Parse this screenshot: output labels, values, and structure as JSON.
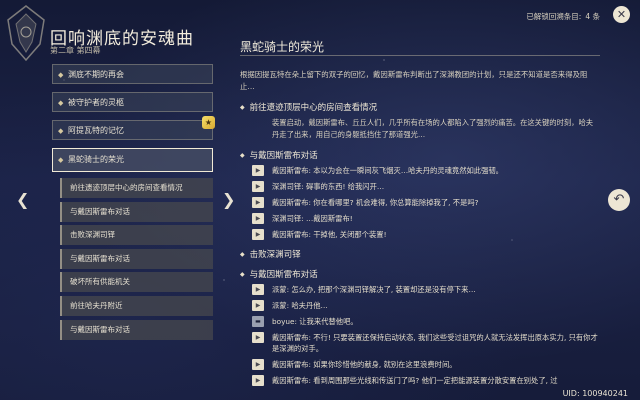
{
  "header": {
    "title": "回响渊底的安魂曲",
    "subtitle": "第二章 第四幕",
    "unlocked_label": "已解锁回溯条目:",
    "unlocked_count": "4 条"
  },
  "chapters": [
    {
      "label": "渊底不期的再会"
    },
    {
      "label": "被守护者的灵柩"
    },
    {
      "label": "阿提瓦特的记忆",
      "badge": "★"
    },
    {
      "label": "黑蛇骑士的荣光",
      "active": true
    }
  ],
  "steps": [
    "前往遗迹顶层中心的房间查看情况",
    "与戴因斯雷布对话",
    "击败深渊司铎",
    "与戴因斯雷布对话",
    "破坏所有供能机关",
    "前往哈夫丹附近",
    "与戴因斯雷布对话"
  ],
  "panel": {
    "title": "黑蛇骑士的荣光",
    "desc": "根据因提瓦特在朵上留下的双子的回忆，戴因斯雷布判断出了深渊教团的计划，只是还不知道是否来得及阻止…",
    "sections": [
      {
        "title": "前往遗迹顶层中心的房间查看情况",
        "para": "装置启动，戴因斯雷布、丘丘人们，几乎所有在场的人都陷入了强烈的痛苦。在这关键的时刻，哈夫丹走了出来，用自己的身躯抵挡住了那道强光…"
      },
      {
        "title": "与戴因斯雷布对话",
        "lines": [
          "戴因斯雷布: 本以为会在一瞬间灰飞烟灭…哈夫丹的灵魂竟然如此强韧。",
          "深渊司铎: 碍事的东西! 给我闪开…",
          "戴因斯雷布: 你在看哪里? 机会难得, 你总算能除掉我了, 不是吗?",
          "深渊司铎: …戴因斯雷布!",
          "戴因斯雷布: 干掉他, 关闭那个装置!"
        ]
      },
      {
        "title": "击败深渊司铎"
      },
      {
        "title": "与戴因斯雷布对话",
        "lines": [
          "派蒙: 怎么办, 把那个深渊司铎解决了, 装置却还是没有停下来…",
          "派蒙: 哈夫丹他…",
          "boyue: 让我来代替他吧。",
          "戴因斯雷布: 不行! 只要装置还保持启动状态, 我们这些受过诅咒的人就无法发挥出原本实力, 只有你才是深渊的对手。",
          "戴因斯雷布: 如果你珍惜他的献身, 就别在这里浪费时间。",
          "戴因斯雷布: 看到周围那些光线和传送门了吗? 他们一定把能源装置分散安置在别处了, 过"
        ]
      }
    ]
  },
  "uid": "UID: 100940241"
}
